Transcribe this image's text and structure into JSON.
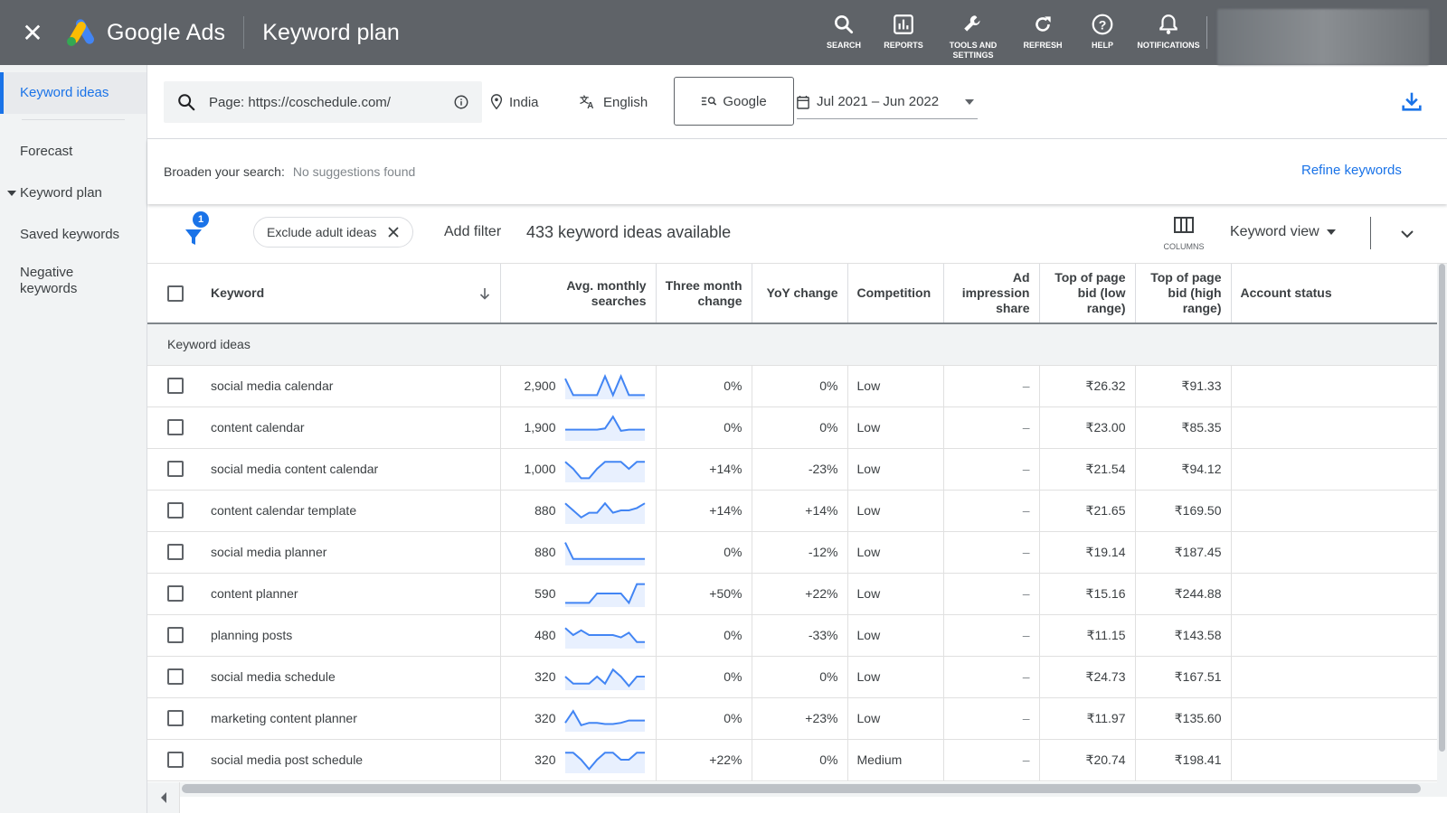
{
  "topbar": {
    "brand": "Google Ads",
    "page_title": "Keyword plan",
    "actions": [
      {
        "label": "SEARCH",
        "icon": "search-icon"
      },
      {
        "label": "REPORTS",
        "icon": "reports-icon"
      },
      {
        "label": "TOOLS AND SETTINGS",
        "icon": "wrench-icon"
      },
      {
        "label": "REFRESH",
        "icon": "refresh-icon"
      },
      {
        "label": "HELP",
        "icon": "help-icon"
      },
      {
        "label": "NOTIFICATIONS",
        "icon": "bell-icon"
      }
    ]
  },
  "sidebar": {
    "items": [
      {
        "label": "Keyword ideas",
        "active": true
      },
      {
        "label": "Forecast"
      },
      {
        "label": "Keyword plan",
        "expandable": true
      },
      {
        "label": "Saved keywords"
      },
      {
        "label": "Negative keywords"
      }
    ]
  },
  "searchbar": {
    "query": "Page: https://coschedule.com/",
    "location": "India",
    "language": "English",
    "network": "Google",
    "date_range": "Jul 2021 – Jun 2022"
  },
  "broaden": {
    "label": "Broaden your search:",
    "value": "No suggestions found",
    "refine_label": "Refine keywords"
  },
  "filters": {
    "badge_count": "1",
    "chip_label": "Exclude adult ideas",
    "add_filter": "Add filter",
    "ideas_count": "433 keyword ideas available",
    "columns_label": "COLUMNS",
    "view_label": "Keyword view"
  },
  "table": {
    "headers": {
      "keyword": "Keyword",
      "avg": "Avg. monthly searches",
      "three_month": "Three month change",
      "yoy": "YoY change",
      "competition": "Competition",
      "ad_share": "Ad impression share",
      "bid_low": "Top of page bid (low range)",
      "bid_high": "Top of page bid (high range)",
      "status": "Account status"
    },
    "group_label": "Keyword ideas",
    "rows": [
      {
        "keyword": "social media calendar",
        "searches": "2,900",
        "trend": [
          0.2,
          0.9,
          0.9,
          0.9,
          0.9,
          0.1,
          0.9,
          0.1,
          0.9,
          0.9,
          0.9
        ],
        "three_month": "0%",
        "yoy": "0%",
        "competition": "Low",
        "ad_share": "–",
        "bid_low": "₹26.32",
        "bid_high": "₹91.33"
      },
      {
        "keyword": "content calendar",
        "searches": "1,900",
        "trend": [
          0.6,
          0.6,
          0.6,
          0.6,
          0.6,
          0.55,
          0.05,
          0.65,
          0.6,
          0.6,
          0.6
        ],
        "three_month": "0%",
        "yoy": "0%",
        "competition": "Low",
        "ad_share": "–",
        "bid_low": "₹23.00",
        "bid_high": "₹85.35"
      },
      {
        "keyword": "social media content calendar",
        "searches": "1,000",
        "trend": [
          0.2,
          0.5,
          0.9,
          0.9,
          0.5,
          0.2,
          0.2,
          0.2,
          0.5,
          0.2,
          0.2
        ],
        "three_month": "+14%",
        "yoy": "-23%",
        "competition": "Low",
        "ad_share": "–",
        "bid_low": "₹21.54",
        "bid_high": "₹94.12"
      },
      {
        "keyword": "content calendar template",
        "searches": "880",
        "trend": [
          0.2,
          0.5,
          0.8,
          0.6,
          0.6,
          0.2,
          0.6,
          0.5,
          0.5,
          0.4,
          0.2
        ],
        "three_month": "+14%",
        "yoy": "+14%",
        "competition": "Low",
        "ad_share": "–",
        "bid_low": "₹21.65",
        "bid_high": "₹169.50"
      },
      {
        "keyword": "social media planner",
        "searches": "880",
        "trend": [
          0.1,
          0.8,
          0.8,
          0.8,
          0.8,
          0.8,
          0.8,
          0.8,
          0.8,
          0.8,
          0.8
        ],
        "three_month": "0%",
        "yoy": "-12%",
        "competition": "Low",
        "ad_share": "–",
        "bid_low": "₹19.14",
        "bid_high": "₹187.45"
      },
      {
        "keyword": "content planner",
        "searches": "590",
        "trend": [
          0.9,
          0.9,
          0.9,
          0.9,
          0.5,
          0.5,
          0.5,
          0.5,
          0.9,
          0.1,
          0.1
        ],
        "three_month": "+50%",
        "yoy": "+22%",
        "competition": "Low",
        "ad_share": "–",
        "bid_low": "₹15.16",
        "bid_high": "₹244.88"
      },
      {
        "keyword": "planning posts",
        "searches": "480",
        "trend": [
          0.2,
          0.5,
          0.3,
          0.5,
          0.5,
          0.5,
          0.5,
          0.6,
          0.4,
          0.8,
          0.8
        ],
        "three_month": "0%",
        "yoy": "-33%",
        "competition": "Low",
        "ad_share": "–",
        "bid_low": "₹11.15",
        "bid_high": "₹143.58"
      },
      {
        "keyword": "social media schedule",
        "searches": "320",
        "trend": [
          0.5,
          0.8,
          0.8,
          0.8,
          0.5,
          0.8,
          0.2,
          0.5,
          0.9,
          0.5,
          0.5
        ],
        "three_month": "0%",
        "yoy": "0%",
        "competition": "Low",
        "ad_share": "–",
        "bid_low": "₹24.73",
        "bid_high": "₹167.51"
      },
      {
        "keyword": "marketing content planner",
        "searches": "320",
        "trend": [
          0.7,
          0.2,
          0.8,
          0.7,
          0.7,
          0.75,
          0.75,
          0.7,
          0.6,
          0.6,
          0.6
        ],
        "three_month": "0%",
        "yoy": "+23%",
        "competition": "Low",
        "ad_share": "–",
        "bid_low": "₹11.97",
        "bid_high": "₹135.60"
      },
      {
        "keyword": "social media post schedule",
        "searches": "320",
        "trend": [
          0.2,
          0.2,
          0.5,
          0.9,
          0.5,
          0.2,
          0.2,
          0.5,
          0.5,
          0.2,
          0.2
        ],
        "three_month": "+22%",
        "yoy": "0%",
        "competition": "Medium",
        "ad_share": "–",
        "bid_low": "₹20.74",
        "bid_high": "₹198.41"
      }
    ]
  },
  "colors": {
    "topbar": "#5f6368",
    "accent": "#1a73e8",
    "sidebar": "#f1f3f4"
  }
}
